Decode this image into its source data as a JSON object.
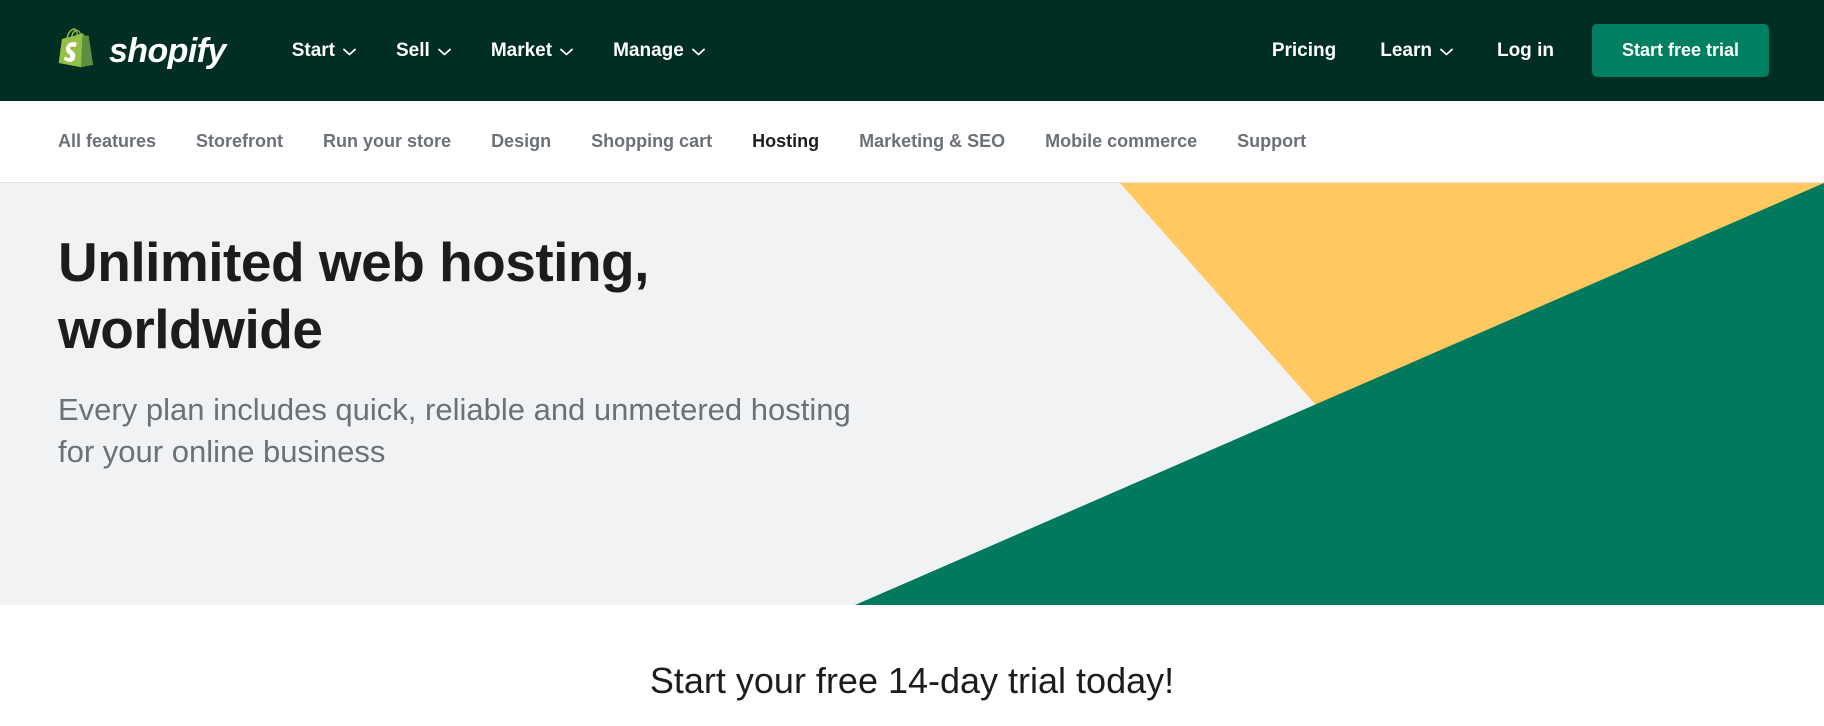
{
  "brand": {
    "name": "shopify",
    "logo_icon": "shopify-bag-logo",
    "colors": {
      "header_bg": "#002E22",
      "hero_bg": "#F1F2F3",
      "accent_green": "#008060",
      "shape_green": "#00795C",
      "shape_yellow": "#FFC861",
      "text_dark": "#1A1C1D",
      "text_muted": "#6B7177"
    }
  },
  "header": {
    "nav": [
      {
        "label": "Start",
        "icon": "chevron-down-icon",
        "has_dropdown": true
      },
      {
        "label": "Sell",
        "icon": "chevron-down-icon",
        "has_dropdown": true
      },
      {
        "label": "Market",
        "icon": "chevron-down-icon",
        "has_dropdown": true
      },
      {
        "label": "Manage",
        "icon": "chevron-down-icon",
        "has_dropdown": true
      }
    ],
    "right_nav": [
      {
        "label": "Pricing",
        "has_dropdown": false
      },
      {
        "label": "Learn",
        "icon": "chevron-down-icon",
        "has_dropdown": true
      },
      {
        "label": "Log in",
        "has_dropdown": false
      }
    ],
    "cta_label": "Start free trial"
  },
  "subnav": {
    "items": [
      {
        "label": "All features",
        "active": false
      },
      {
        "label": "Storefront",
        "active": false
      },
      {
        "label": "Run your store",
        "active": false
      },
      {
        "label": "Design",
        "active": false
      },
      {
        "label": "Shopping cart",
        "active": false
      },
      {
        "label": "Hosting",
        "active": true
      },
      {
        "label": "Marketing & SEO",
        "active": false
      },
      {
        "label": "Mobile commerce",
        "active": false
      },
      {
        "label": "Support",
        "active": false
      }
    ]
  },
  "hero": {
    "title": "Unlimited web hosting, worldwide",
    "subtitle": "Every plan includes quick, reliable and unmetered hosting for your online business"
  },
  "trial": {
    "title": "Start your free 14-day trial today!"
  }
}
